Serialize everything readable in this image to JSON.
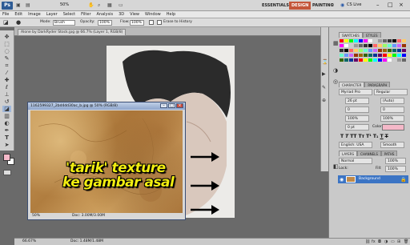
{
  "app": {
    "logo": "Ps",
    "zoom": "50%",
    "workspaces": [
      "ESSENTIALS",
      "DESIGN",
      "PAINTING"
    ],
    "active_workspace": "DESIGN",
    "cs_live": "CS Live"
  },
  "menu": [
    "File",
    "Edit",
    "Image",
    "Layer",
    "Select",
    "Filter",
    "Analysis",
    "3D",
    "View",
    "Window",
    "Help"
  ],
  "options": {
    "mode_label": "Mode:",
    "mode_value": "Brush",
    "opacity_label": "Opacity:",
    "opacity_value": "100%",
    "flow_label": "Flow:",
    "flow_value": "100%",
    "erase_label": "Erase to History"
  },
  "document": {
    "tab_title": "Alone by DarkRyder Stock.jpg @ 66.7% (Layer 1, RGB/8)",
    "zoom": "66.67%",
    "doc_info": "Doc: 1.48M/1.48M"
  },
  "texture_window": {
    "title": "1162599327_2bd4dd30ac_b.jpg @ 50% (RGB/8)",
    "zoom": "50%",
    "doc_info": "Doc: 3.00M/3.00M"
  },
  "overlay": {
    "line1": "'tarik' texture",
    "line2": "ke gambar asal"
  },
  "panels": {
    "swatch_tabs": [
      "SWATCHES",
      "STYLES"
    ],
    "char_tabs": [
      "CHARACTER",
      "PARAGRAPH"
    ],
    "font_family": "Myriad Pro",
    "font_style": "Regular",
    "font_size": "26 pt",
    "leading": "(Auto)",
    "kerning": "0",
    "tracking": "0",
    "vscale": "100%",
    "hscale": "100%",
    "baseline": "0 pt",
    "color_label": "Color:",
    "language": "English: USA",
    "aa": "Smooth",
    "layer_tabs": [
      "LAYERS",
      "CHANNELS",
      "PATHS"
    ],
    "blend_mode": "Normal",
    "opacity": "100%",
    "lock_label": "Lock:",
    "fill_label": "Fill:",
    "fill": "100%",
    "layer_name": "Background"
  },
  "colors": {
    "foreground": "#f4b8c8",
    "background": "#ffffff",
    "accent": "#c4563b",
    "overlay_text": "#f2ee10"
  }
}
